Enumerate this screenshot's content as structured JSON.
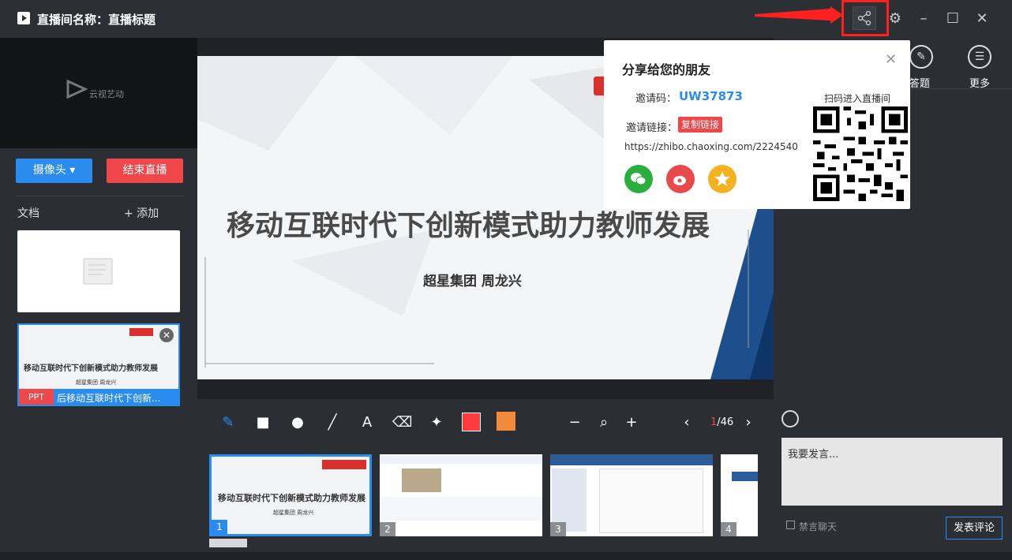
{
  "window": {
    "title": "直播间名称：直播标题"
  },
  "left_panel": {
    "camera_button": "摄像头 ▾",
    "end_live_button": "结束直播",
    "docs_label": "文档",
    "add_button": "+ 添加",
    "ppt_doc": {
      "badge": "PPT",
      "name": "后移动互联时代下创新...",
      "thumb_title": "移动互联时代下创新模式助力教师发展",
      "thumb_sub": "超星集团    周龙兴"
    },
    "logo_text": "云视艺动"
  },
  "slide": {
    "title": "移动互联时代下创新模式助力教师发展",
    "subtitle": "超星集团    周龙兴"
  },
  "toolbar": {
    "page_current": "1",
    "page_total": "/46",
    "colors": [
      "#ff3b3b",
      "#f08a3c"
    ]
  },
  "thumbnails": [
    {
      "num": "1",
      "title": "移动互联时代下创新模式助力教师发展",
      "sub": "超星集团    周龙兴"
    },
    {
      "num": "2"
    },
    {
      "num": "3"
    },
    {
      "num": "4"
    }
  ],
  "right_panel": {
    "answer_label": "答题",
    "more_label": "更多",
    "chat_placeholder": "我要发言...",
    "mute_label": "禁言聊天",
    "post_button": "发表评论"
  },
  "share_popup": {
    "title": "分享给您的朋友",
    "invite_code_label": "邀请码：",
    "invite_code": "UW37873",
    "invite_link_label": "邀请链接：",
    "copy_link": "复制链接",
    "url": "https://zhibo.chaoxing.com/2224540",
    "qr_label": "扫码进入直播间"
  }
}
